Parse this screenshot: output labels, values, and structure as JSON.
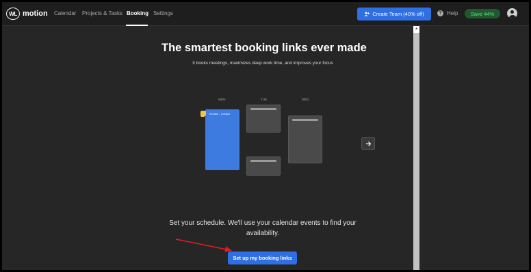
{
  "nav": {
    "logo_text": "WL",
    "brand": "motion",
    "links": [
      "Calendar",
      "Projects & Tasks",
      "Booking",
      "Settings"
    ],
    "active": "Booking",
    "create_team_label": "Create Team (40% off)",
    "help_label": "Help",
    "save_badge": "Save 44%"
  },
  "hero": {
    "title": "The smartest booking links ever made",
    "subtitle": "It books meetings, maximizes deep work time, and improves your focus"
  },
  "illustration": {
    "days": [
      "MON",
      "TUE",
      "WED"
    ],
    "event_time": "9:00am - 2:00pm"
  },
  "cta_section": {
    "text": "Set your schedule. We'll use your calendar events to find your availability.",
    "button_label": "Set up my booking links"
  },
  "colors": {
    "accent": "#2f6fe4",
    "annotation_arrow": "#e02020",
    "save_badge_text": "#5fe08a"
  },
  "icons": [
    "user-plus-icon",
    "help-icon",
    "avatar-icon",
    "arrow-right-icon",
    "cursor-hand-icon"
  ]
}
